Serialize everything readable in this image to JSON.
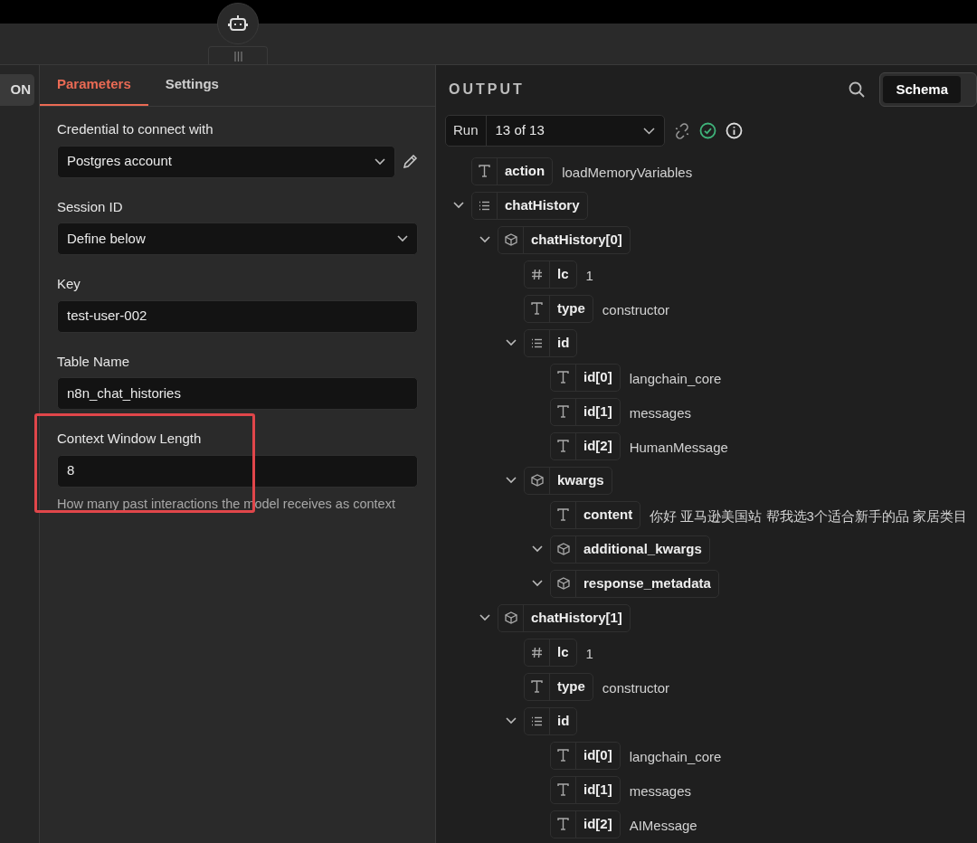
{
  "side_button": {
    "label": "ON"
  },
  "tabs": [
    {
      "label": "Parameters",
      "selected": true
    },
    {
      "label": "Settings",
      "selected": false
    }
  ],
  "fields": [
    {
      "kind": "select",
      "label": "Credential to connect with",
      "value": "Postgres account",
      "editable": true,
      "highlighted": false
    },
    {
      "kind": "select",
      "label": "Session ID",
      "value": "Define below",
      "editable": false,
      "highlighted": false
    },
    {
      "kind": "input",
      "label": "Key",
      "value": "test-user-002",
      "editable": false,
      "highlighted": false
    },
    {
      "kind": "input",
      "label": "Table Name",
      "value": "n8n_chat_histories",
      "editable": false,
      "highlighted": false
    },
    {
      "kind": "input",
      "label": "Context Window Length",
      "value": "8",
      "hint": "How many past interactions the model receives as context",
      "editable": false,
      "highlighted": true
    }
  ],
  "output": {
    "title": "OUTPUT",
    "views": [
      {
        "label": "Schema",
        "selected": true
      }
    ],
    "run": {
      "label": "Run",
      "value": "13 of 13"
    },
    "tree": [
      {
        "key": "action",
        "kind": "string",
        "value": "loadMemoryVariables"
      },
      {
        "key": "chatHistory",
        "kind": "array",
        "expanded": true,
        "children": [
          {
            "key": "chatHistory[0]",
            "kind": "object",
            "expanded": true,
            "children": [
              {
                "key": "lc",
                "kind": "number",
                "value": "1"
              },
              {
                "key": "type",
                "kind": "string",
                "value": "constructor"
              },
              {
                "key": "id",
                "kind": "array",
                "expanded": true,
                "children": [
                  {
                    "key": "id[0]",
                    "kind": "string",
                    "value": "langchain_core"
                  },
                  {
                    "key": "id[1]",
                    "kind": "string",
                    "value": "messages"
                  },
                  {
                    "key": "id[2]",
                    "kind": "string",
                    "value": "HumanMessage"
                  }
                ]
              },
              {
                "key": "kwargs",
                "kind": "object",
                "expanded": true,
                "children": [
                  {
                    "key": "content",
                    "kind": "string",
                    "value": "你好 亚马逊美国站 帮我选3个适合新手的品 家居类目"
                  },
                  {
                    "key": "additional_kwargs",
                    "kind": "object",
                    "expanded": true
                  },
                  {
                    "key": "response_metadata",
                    "kind": "object",
                    "expanded": true
                  }
                ]
              }
            ]
          },
          {
            "key": "chatHistory[1]",
            "kind": "object",
            "expanded": true,
            "children": [
              {
                "key": "lc",
                "kind": "number",
                "value": "1"
              },
              {
                "key": "type",
                "kind": "string",
                "value": "constructor"
              },
              {
                "key": "id",
                "kind": "array",
                "expanded": true,
                "children": [
                  {
                    "key": "id[0]",
                    "kind": "string",
                    "value": "langchain_core"
                  },
                  {
                    "key": "id[1]",
                    "kind": "string",
                    "value": "messages"
                  },
                  {
                    "key": "id[2]",
                    "kind": "string",
                    "value": "AIMessage"
                  }
                ]
              }
            ]
          }
        ]
      }
    ]
  }
}
